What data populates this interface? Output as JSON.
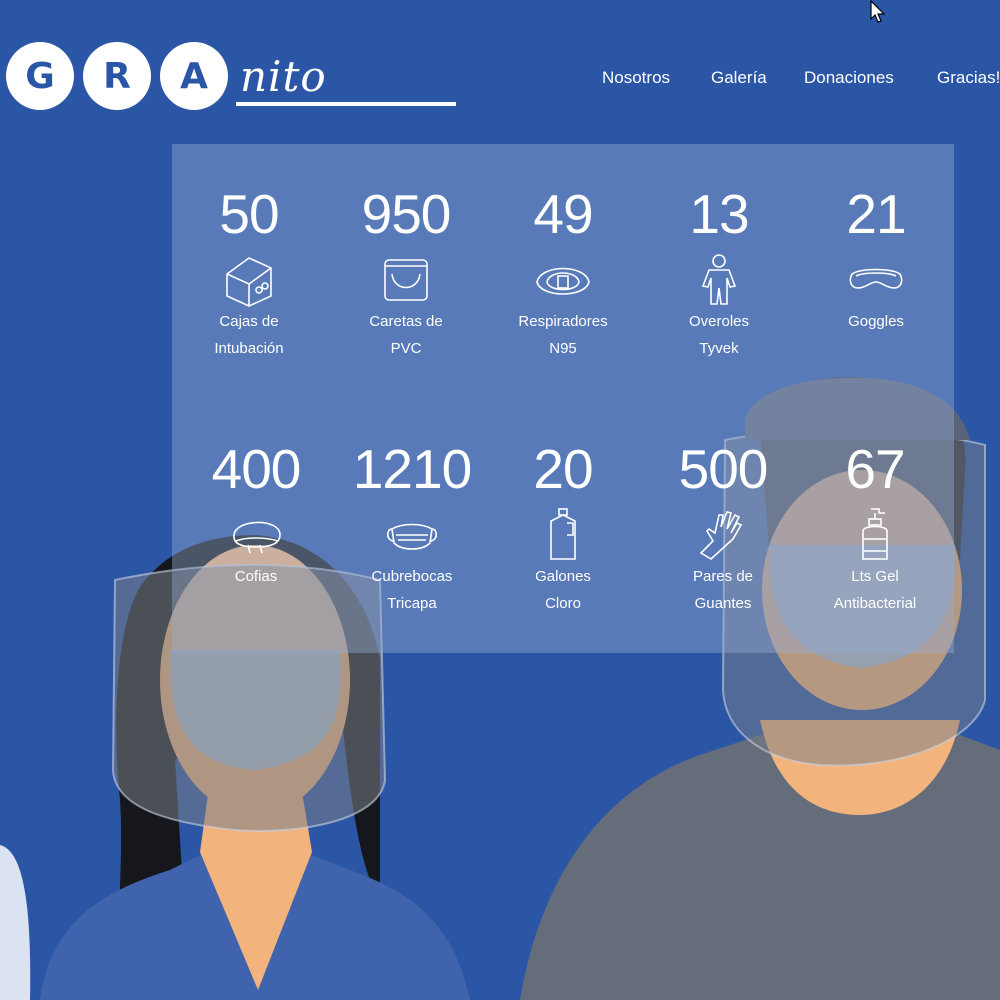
{
  "logo": {
    "letters": [
      "G",
      "R",
      "A"
    ],
    "script": "nito"
  },
  "nav": {
    "items": [
      "Nosotros",
      "Galería",
      "Donaciones",
      "Gracias!"
    ]
  },
  "stats": [
    {
      "value": "50",
      "label_line1": "Cajas de",
      "label_line2": "Intubación",
      "icon": "intubation-box-icon"
    },
    {
      "value": "950",
      "label_line1": "Caretas de",
      "label_line2": "PVC",
      "icon": "face-shield-icon"
    },
    {
      "value": "49",
      "label_line1": "Respiradores",
      "label_line2": "N95",
      "icon": "respirator-icon"
    },
    {
      "value": "13",
      "label_line1": "Overoles",
      "label_line2": "Tyvek",
      "icon": "coverall-icon"
    },
    {
      "value": "21",
      "label_line1": "Goggles",
      "label_line2": "",
      "icon": "goggles-icon"
    },
    {
      "value": "400",
      "label_line1": "Cofias",
      "label_line2": "",
      "icon": "cap-icon"
    },
    {
      "value": "1210",
      "label_line1": "Cubrebocas",
      "label_line2": "Tricapa",
      "icon": "face-mask-icon"
    },
    {
      "value": "20",
      "label_line1": "Galones",
      "label_line2": "Cloro",
      "icon": "gallon-icon"
    },
    {
      "value": "500",
      "label_line1": "Pares de",
      "label_line2": "Guantes",
      "icon": "glove-icon"
    },
    {
      "value": "67",
      "label_line1": "Lts Gel",
      "label_line2": "Antibacterial",
      "icon": "sanitizer-bottle-icon"
    }
  ],
  "colors": {
    "background": "#2b56a6",
    "text": "#ffffff",
    "panel": "rgba(150,172,210,0.42)"
  }
}
